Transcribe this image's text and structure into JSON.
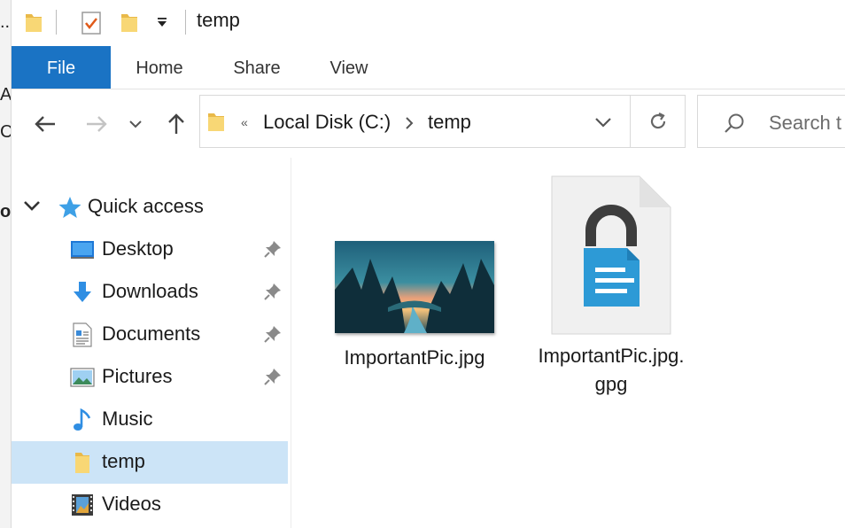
{
  "behind": {
    "line1": "..",
    "line2": "A",
    "line3": "Ce",
    "line4": "o"
  },
  "window": {
    "title": "temp"
  },
  "ribbon": {
    "tabs": [
      "File",
      "Home",
      "Share",
      "View"
    ]
  },
  "address": {
    "root": "Local Disk (C:)",
    "folder": "temp",
    "overflow": "«"
  },
  "search": {
    "placeholder": "Search t"
  },
  "nav": {
    "quick_access": "Quick access",
    "items": [
      {
        "label": "Desktop",
        "icon": "desktop-icon",
        "pinned": true
      },
      {
        "label": "Downloads",
        "icon": "downloads-icon",
        "pinned": true
      },
      {
        "label": "Documents",
        "icon": "documents-icon",
        "pinned": true
      },
      {
        "label": "Pictures",
        "icon": "pictures-icon",
        "pinned": true
      },
      {
        "label": "Music",
        "icon": "music-icon",
        "pinned": false
      },
      {
        "label": "temp",
        "icon": "folder-icon",
        "pinned": false,
        "selected": true
      },
      {
        "label": "Videos",
        "icon": "videos-icon",
        "pinned": false
      }
    ]
  },
  "files": [
    {
      "name": "ImportantPic.jpg",
      "type": "image-thumbnail"
    },
    {
      "name_line1": "ImportantPic.jpg.",
      "name_line2": "gpg",
      "type": "encrypted-file-icon"
    }
  ],
  "colors": {
    "accent": "#1a73c4",
    "selection": "#cce4f7",
    "folder": "#f8d775",
    "lock_blue": "#2d9ad6"
  }
}
